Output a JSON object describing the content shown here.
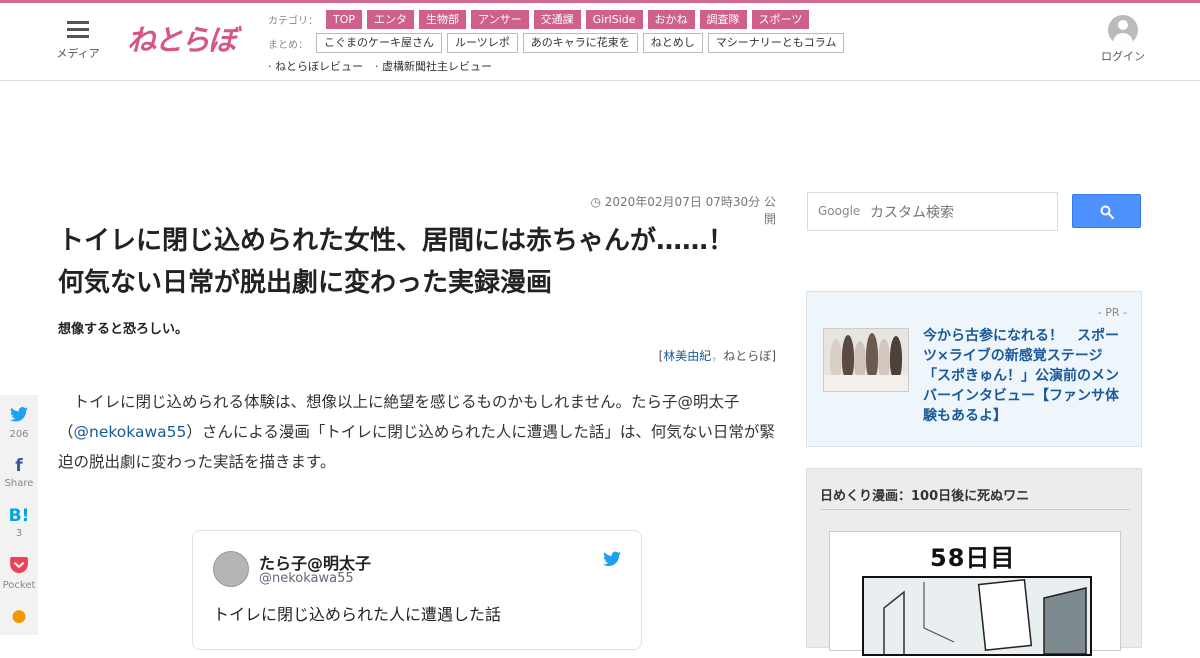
{
  "header": {
    "menu_label": "メディア",
    "logo_text": "ねとらぼ",
    "category_label": "カテゴリ：",
    "categories": [
      "TOP",
      "エンタ",
      "生物部",
      "アンサー",
      "交通課",
      "GirlSide",
      "おかね",
      "調査隊",
      "スポーツ"
    ],
    "summary_label": "まとめ：",
    "summaries": [
      "こぐまのケーキ屋さん",
      "ルーツレポ",
      "あのキャラに花束を",
      "ねとめし",
      "マシーナリーともコラム"
    ],
    "sub_links": [
      "· ねとらぼレビュー",
      "· 虚構新聞社主レビュー"
    ],
    "login_label": "ログイン",
    "accent_color": "#cf5f8d"
  },
  "share": [
    {
      "icon": "twitter-icon",
      "glyph": "t",
      "count": "206"
    },
    {
      "icon": "facebook-icon",
      "glyph": "f",
      "count": "Share"
    },
    {
      "icon": "hatena-icon",
      "glyph": "B!",
      "count": "3"
    },
    {
      "icon": "pocket-icon",
      "glyph": "P",
      "count": "Pocket"
    },
    {
      "icon": "line-icon",
      "glyph": "●",
      "count": ""
    }
  ],
  "article": {
    "date": "2020年02月07日 07時30分 公開",
    "title": "トイレに閉じ込められた女性、居間には赤ちゃんが……！　何気ない日常が脱出劇に変わった実録漫画",
    "subtitle": "想像すると恐ろしい。",
    "author_open": "[",
    "author_name": "林美由紀",
    "author_sep": "，",
    "author_site": "ねとらぼ",
    "author_close": "]",
    "lead_1": "　トイレに閉じ込められる体験は、想像以上に絶望を感じるものかもしれません。たら子@明太子（",
    "lead_mention": "@nekokawa55",
    "lead_2": "）さんによる漫画「トイレに閉じ込められた人に遭遇した話」は、何気ない日常が緊迫の脱出劇に変わった実話を描きます。"
  },
  "tweet": {
    "name": "たら子@明太子",
    "handle": "@nekokawa55",
    "text": "トイレに閉じ込められた人に遭遇した話"
  },
  "sidebar": {
    "search_brand": "Google",
    "search_placeholder": "カスタム検索",
    "pr_label": "- PR -",
    "pr_text": "今から古参になれる！　スポーツ×ライブの新感覚ステージ「スポきゅん！」公演前のメンバーインタビュー【ファンサ体験もあるよ】",
    "manga_title": "日めくり漫画：100日後に死ぬワニ",
    "manga_day": "58日目"
  }
}
